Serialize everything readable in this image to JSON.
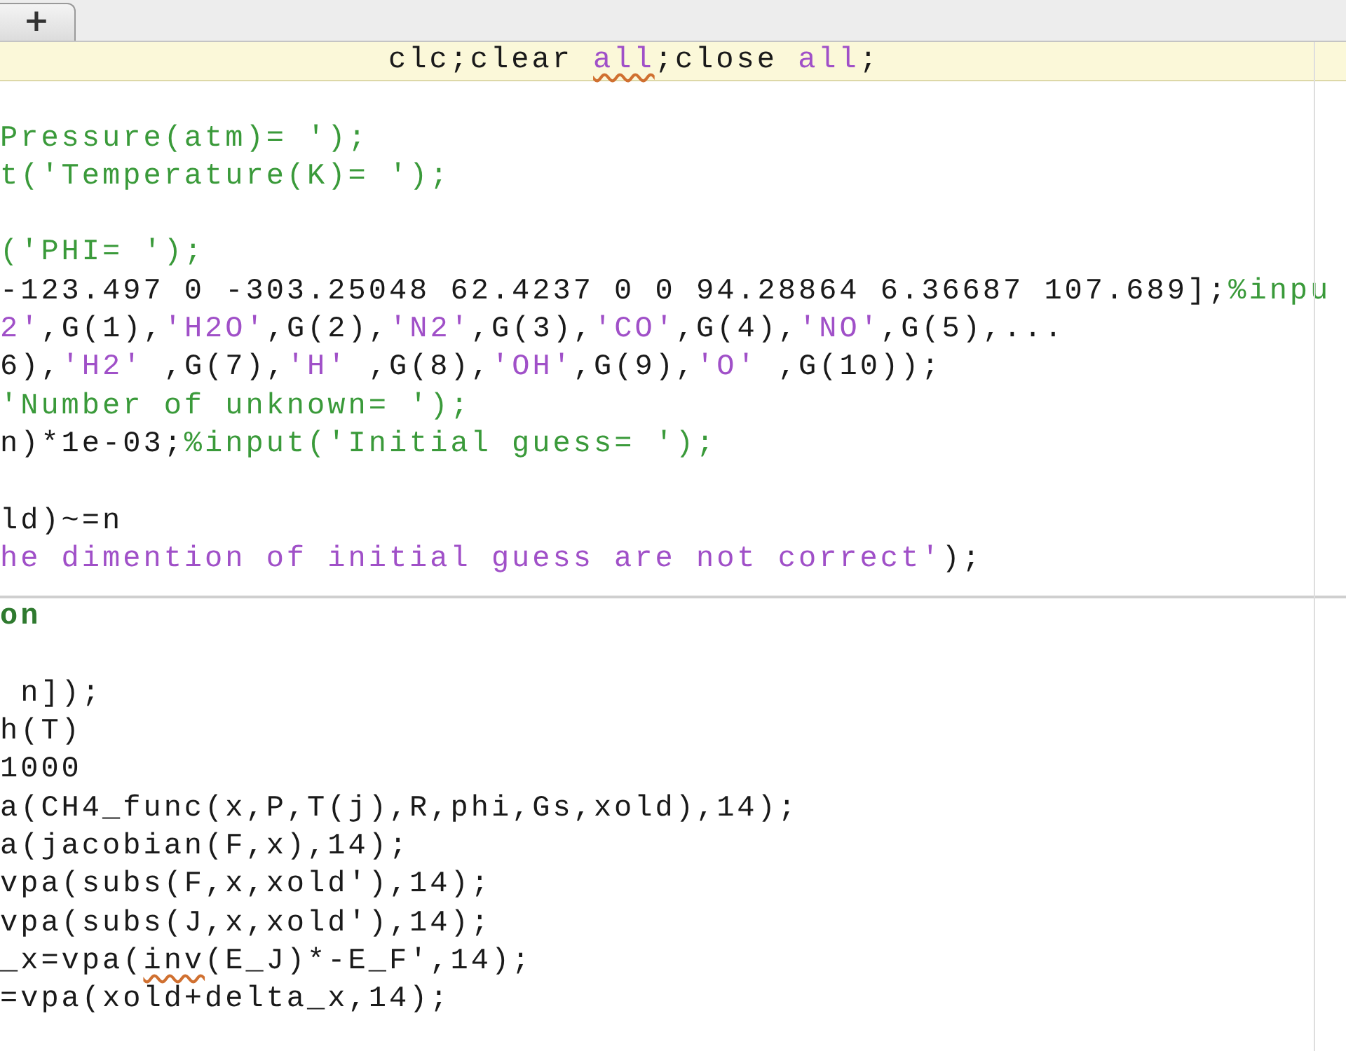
{
  "tabs": [
    {
      "label": "+"
    }
  ],
  "cells": [
    {
      "lines": [
        {
          "highlighted": true,
          "segments": [
            {
              "kind": "plain",
              "text": "clc;clear ",
              "warning": false
            },
            {
              "kind": "string",
              "text": "all",
              "warning": true
            },
            {
              "kind": "plain",
              "text": ";close ",
              "warning": false
            },
            {
              "kind": "string",
              "text": "all",
              "warning": false
            },
            {
              "kind": "plain",
              "text": ";",
              "warning": false
            }
          ]
        },
        {
          "highlighted": false
        },
        {
          "highlighted": false,
          "segments": [
            {
              "kind": "comment",
              "text": "Pressure(atm)= ');",
              "warning": false
            }
          ]
        },
        {
          "highlighted": false,
          "segments": [
            {
              "kind": "comment",
              "text": "t('Temperature(K)= ');",
              "warning": false
            }
          ]
        },
        {
          "highlighted": false
        },
        {
          "highlighted": false,
          "segments": [
            {
              "kind": "comment",
              "text": "('PHI= ');",
              "warning": false
            }
          ]
        },
        {
          "highlighted": false,
          "segments": [
            {
              "kind": "plain",
              "text": "-123.497 0 -303.25048 62.4237 0 0 94.28864 6.36687 107.689];",
              "warning": false
            },
            {
              "kind": "comment",
              "text": "%inpu",
              "warning": false
            }
          ]
        },
        {
          "highlighted": false,
          "segments": [
            {
              "kind": "string",
              "text": "2'",
              "warning": false
            },
            {
              "kind": "plain",
              "text": ",G(1),",
              "warning": false
            },
            {
              "kind": "string",
              "text": "'H2O'",
              "warning": false
            },
            {
              "kind": "plain",
              "text": ",G(2),",
              "warning": false
            },
            {
              "kind": "string",
              "text": "'N2'",
              "warning": false
            },
            {
              "kind": "plain",
              "text": ",G(3),",
              "warning": false
            },
            {
              "kind": "string",
              "text": "'CO'",
              "warning": false
            },
            {
              "kind": "plain",
              "text": ",G(4),",
              "warning": false
            },
            {
              "kind": "string",
              "text": "'NO'",
              "warning": false
            },
            {
              "kind": "plain",
              "text": ",G(5),...",
              "warning": false
            }
          ]
        },
        {
          "highlighted": false,
          "segments": [
            {
              "kind": "plain",
              "text": "6),",
              "warning": false
            },
            {
              "kind": "string",
              "text": "'H2'",
              "warning": false
            },
            {
              "kind": "plain",
              "text": " ,G(7),",
              "warning": false
            },
            {
              "kind": "string",
              "text": "'H'",
              "warning": false
            },
            {
              "kind": "plain",
              "text": " ,G(8),",
              "warning": false
            },
            {
              "kind": "string",
              "text": "'OH'",
              "warning": false
            },
            {
              "kind": "plain",
              "text": ",G(9),",
              "warning": false
            },
            {
              "kind": "string",
              "text": "'O'",
              "warning": false
            },
            {
              "kind": "plain",
              "text": " ,G(10));",
              "warning": false
            }
          ]
        },
        {
          "highlighted": false,
          "segments": [
            {
              "kind": "comment",
              "text": "'Number of unknown= ');",
              "warning": false
            }
          ]
        },
        {
          "highlighted": false,
          "segments": [
            {
              "kind": "plain",
              "text": "n)*1e-03;",
              "warning": false
            },
            {
              "kind": "comment",
              "text": "%input('Initial guess= ');",
              "warning": false
            }
          ]
        },
        {
          "highlighted": false
        },
        {
          "highlighted": false,
          "segments": [
            {
              "kind": "plain",
              "text": "ld)~=n",
              "warning": false
            }
          ]
        },
        {
          "highlighted": false,
          "segments": [
            {
              "kind": "string",
              "text": "he dimention of initial guess are not correct'",
              "warning": false
            },
            {
              "kind": "plain",
              "text": ");",
              "warning": false
            }
          ]
        }
      ]
    },
    {
      "lines": [
        {
          "highlighted": false,
          "segments": [
            {
              "kind": "cell_title",
              "text": "on",
              "warning": false
            }
          ]
        },
        {
          "highlighted": false
        },
        {
          "highlighted": false,
          "segments": [
            {
              "kind": "plain",
              "text": " n]);",
              "warning": false
            }
          ]
        },
        {
          "highlighted": false,
          "segments": [
            {
              "kind": "plain",
              "text": "h(T)",
              "warning": false
            }
          ]
        },
        {
          "highlighted": false,
          "segments": [
            {
              "kind": "plain",
              "text": "1000",
              "warning": false
            }
          ]
        },
        {
          "highlighted": false,
          "segments": [
            {
              "kind": "plain",
              "text": "a(CH4_func(x,P,T(j),R,phi,Gs,xold),14);",
              "warning": false
            }
          ]
        },
        {
          "highlighted": false,
          "segments": [
            {
              "kind": "plain",
              "text": "a(jacobian(F,x),14);",
              "warning": false
            }
          ]
        },
        {
          "highlighted": false,
          "segments": [
            {
              "kind": "plain",
              "text": "vpa(subs(F,x,xold'),14);",
              "warning": false
            }
          ]
        },
        {
          "highlighted": false,
          "segments": [
            {
              "kind": "plain",
              "text": "vpa(subs(J,x,xold'),14);",
              "warning": false
            }
          ]
        },
        {
          "highlighted": false,
          "segments": [
            {
              "kind": "plain",
              "text": "_x=vpa(",
              "warning": false
            },
            {
              "kind": "plain",
              "text": "inv",
              "warning": true
            },
            {
              "kind": "plain",
              "text": "(E_J)*-E_F',14);",
              "warning": false
            }
          ]
        },
        {
          "highlighted": false,
          "segments": [
            {
              "kind": "plain",
              "text": "=vpa(xold+delta_x,14);",
              "warning": false
            }
          ]
        }
      ]
    }
  ]
}
